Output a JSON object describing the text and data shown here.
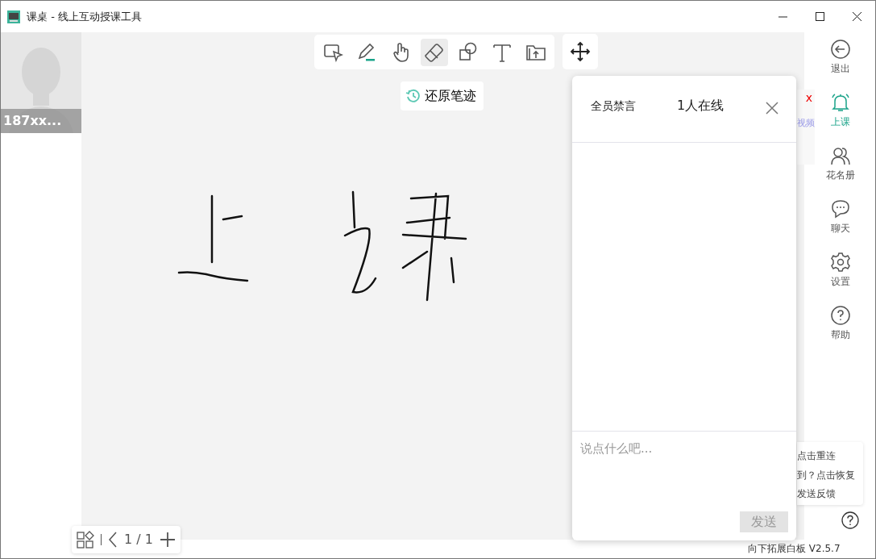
{
  "window": {
    "title": "课桌 - 线上互动授课工具"
  },
  "video_tile": {
    "name": "187xx..."
  },
  "toolbar": {
    "tools": [
      {
        "kind": "select",
        "selected": false
      },
      {
        "kind": "pen",
        "selected": false,
        "color": "#1aa389"
      },
      {
        "kind": "hand",
        "selected": false
      },
      {
        "kind": "eraser",
        "selected": true
      },
      {
        "kind": "shape",
        "selected": false
      },
      {
        "kind": "text",
        "selected": false
      },
      {
        "kind": "upload",
        "selected": false
      }
    ]
  },
  "restore_button": {
    "label": "还原笔迹"
  },
  "pager": {
    "page": "1 / 1"
  },
  "chat_panel": {
    "mute_all": "全员禁言",
    "online": "1人在线",
    "input": {
      "placeholder": "说点什么吧..."
    },
    "send_button": {
      "label": "发送",
      "disabled": true
    }
  },
  "side_menu": [
    {
      "kind": "exit",
      "label": "退出",
      "selected": false
    },
    {
      "kind": "bell",
      "label": "上课",
      "selected": true
    },
    {
      "kind": "roster",
      "label": "花名册",
      "selected": false
    },
    {
      "kind": "chat",
      "label": "聊天",
      "selected": false
    },
    {
      "kind": "settings",
      "label": "设置",
      "selected": false
    },
    {
      "kind": "help",
      "label": "帮助",
      "selected": false
    }
  ],
  "hidden_popup": {
    "close": "x",
    "text": "视频"
  },
  "help_popup": {
    "items": [
      "点击重连",
      "到？点击恢复",
      "发送反馈"
    ]
  },
  "footer": {
    "version": "向下拓展白板 V2.5.7"
  }
}
